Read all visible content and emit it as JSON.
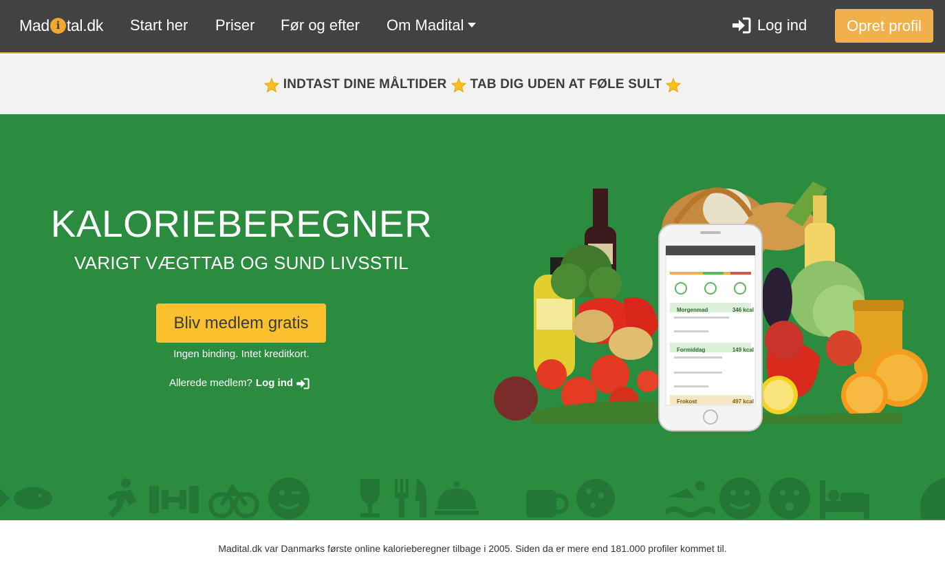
{
  "nav": {
    "brand_left": "Mad",
    "brand_dot": "i",
    "brand_right": "tal.dk",
    "links": [
      "Start her",
      "Priser",
      "Før og efter",
      "Om Madital"
    ],
    "login": "Log ind",
    "signup": "Opret profil"
  },
  "tagline": {
    "part1": "INDTAST DINE MÅLTIDER",
    "part2": "TAB DIG UDEN AT FØLE SULT"
  },
  "hero": {
    "title": "KALORIEBEREGNER",
    "subtitle": "VARIGT VÆGTTAB OG SUND LIVSSTIL",
    "cta": "Bliv medlem gratis",
    "note": "Ingen binding. Intet kreditkort.",
    "already": "Allerede medlem?",
    "login_link": "Log ind"
  },
  "phone": {
    "rows": [
      {
        "label": "Morgenmad",
        "kcal": "346 kcal"
      },
      {
        "label": "Formiddag",
        "kcal": "149 kcal"
      },
      {
        "label": "Frokost",
        "kcal": "497 kcal"
      }
    ]
  },
  "footer": {
    "text": "Madital.dk var Danmarks første online kalorieberegner tilbage i 2005. Siden da er mere end 181.000 profiler kommet til."
  },
  "colors": {
    "nav_bg": "#424242",
    "accent_orange": "#f0b14a",
    "hero_green": "#2b8c3f",
    "cta_yellow": "#fbc02d",
    "tag_bg": "#f2f2f2"
  }
}
